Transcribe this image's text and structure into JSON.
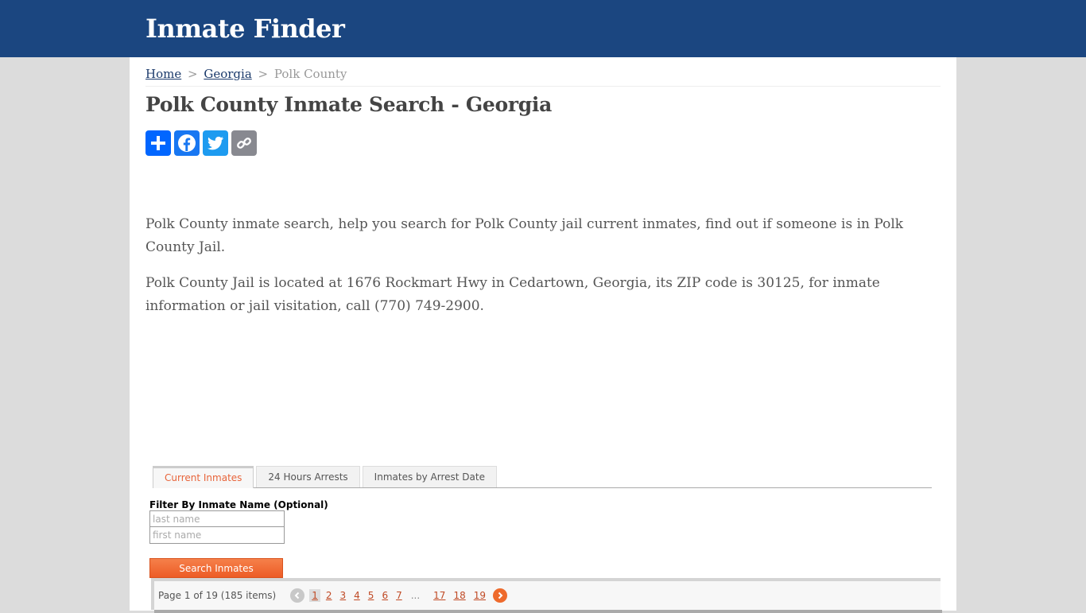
{
  "header": {
    "site_title": "Inmate Finder"
  },
  "breadcrumb": {
    "items": [
      "Home",
      "Georgia"
    ],
    "current": "Polk County",
    "separator": ">"
  },
  "page_title": "Polk County Inmate Search - Georgia",
  "share": {
    "buttons": [
      "share-add",
      "facebook",
      "twitter",
      "copy-link"
    ]
  },
  "intro": {
    "paragraphs": [
      "Polk County inmate search, help you search for Polk County jail current inmates, find out if someone is in Polk County Jail.",
      "Polk County Jail is located at 1676 Rockmart Hwy in Cedartown, Georgia, its ZIP code is 30125, for inmate information or jail visitation, call (770) 749-2900."
    ]
  },
  "widget": {
    "tabs": [
      {
        "label": "Current Inmates",
        "active": true
      },
      {
        "label": "24 Hours Arrests",
        "active": false
      },
      {
        "label": "Inmates by Arrest Date",
        "active": false
      }
    ],
    "filter_label": "Filter By Inmate Name (Optional)",
    "last_name_placeholder": "last name",
    "first_name_placeholder": "first name",
    "search_button": "Search Inmates",
    "pager": {
      "summary": "Page 1 of 19 (185 items)",
      "pages": [
        "1",
        "2",
        "3",
        "4",
        "5",
        "6",
        "7"
      ],
      "ellipsis": "...",
      "tail_pages": [
        "17",
        "18",
        "19"
      ],
      "current_page": "1"
    }
  },
  "colors": {
    "header_bg": "#1b4680",
    "accent_orange": "#ee6a2c",
    "link": "#c04a25"
  }
}
